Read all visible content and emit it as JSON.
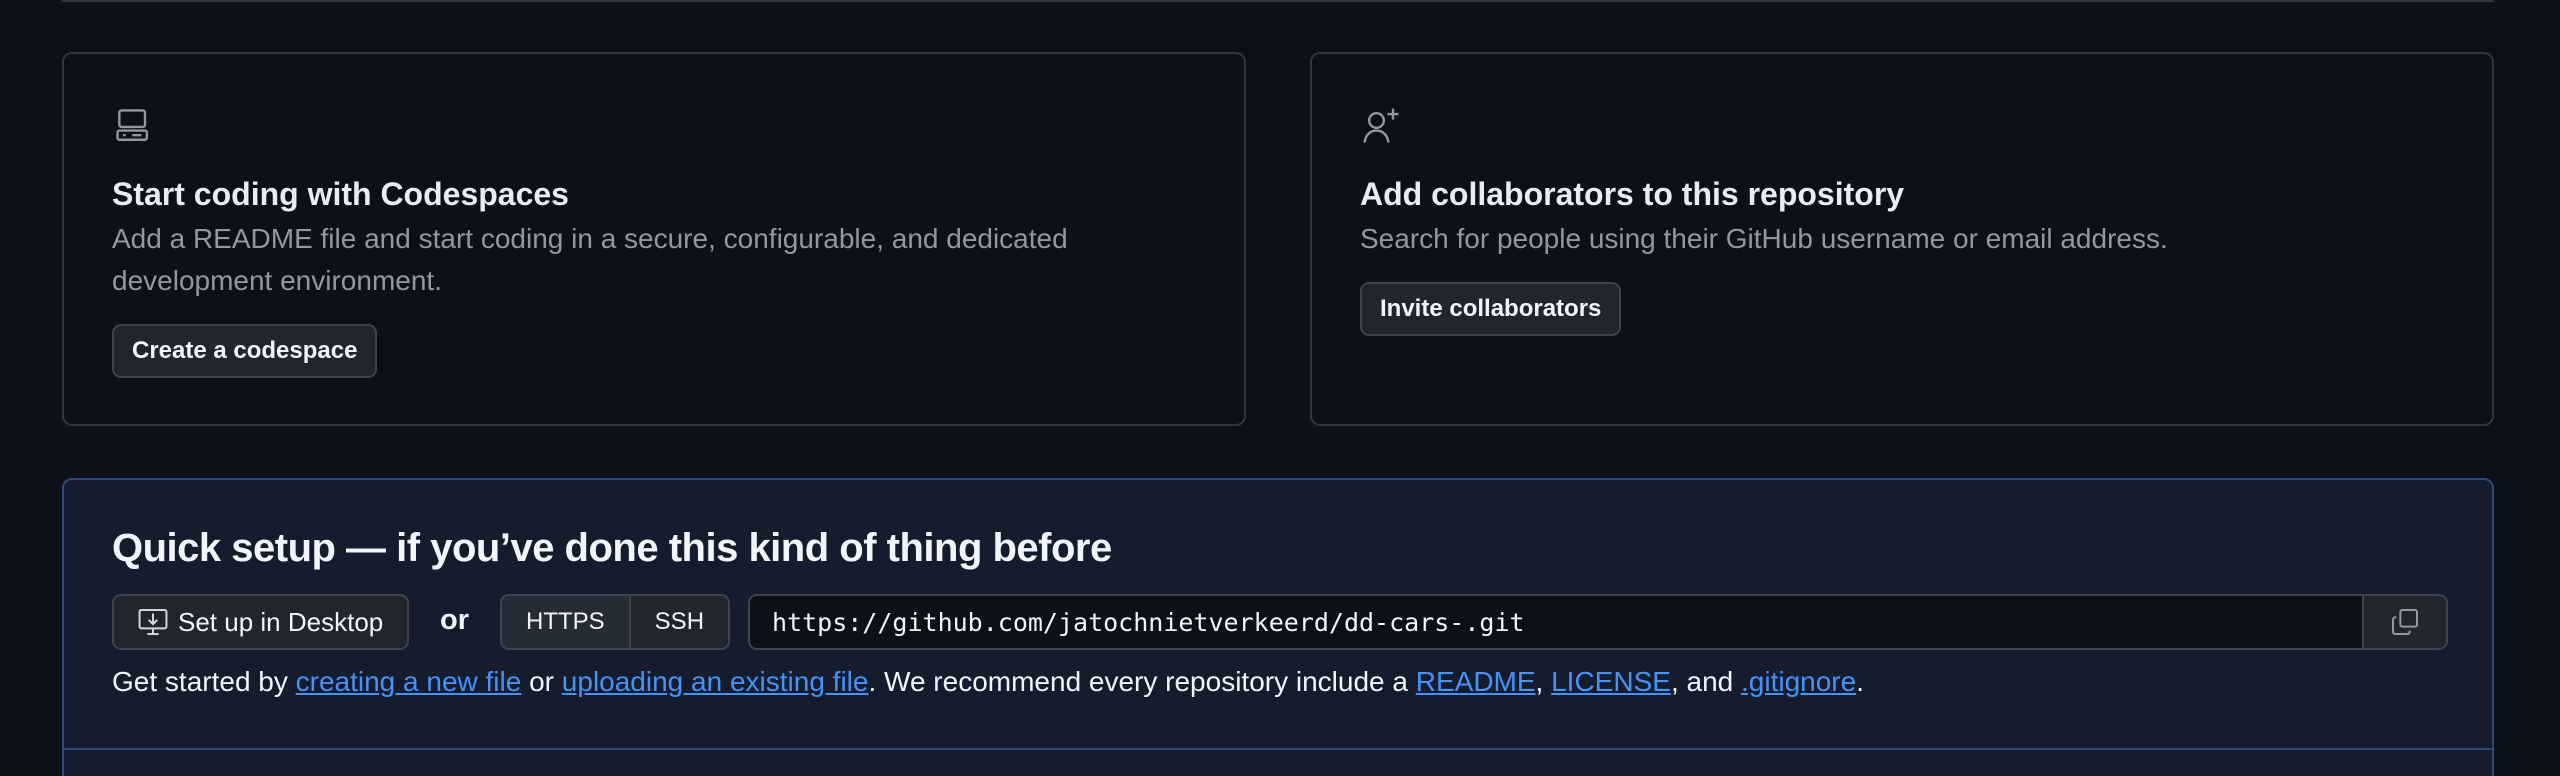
{
  "codespaces_card": {
    "icon": "codespaces-icon",
    "title": "Start coding with Codespaces",
    "description": "Add a README file and start coding in a secure, configurable, and dedicated development environment.",
    "button_label": "Create a codespace"
  },
  "collaborators_card": {
    "icon": "person-add-icon",
    "title": "Add collaborators to this repository",
    "description": "Search for people using their GitHub username or email address.",
    "button_label": "Invite collaborators"
  },
  "quick_setup": {
    "title": "Quick setup — if you’ve done this kind of thing before",
    "desktop_button_label": "Set up in Desktop",
    "desktop_icon": "desktop-download-icon",
    "or_label": "or",
    "protocols": [
      "HTTPS",
      "SSH"
    ],
    "selected_protocol": "HTTPS",
    "clone_url": "https://github.com/jatochnietverkeerd/dd-cars-.git",
    "copy_icon": "copy-icon",
    "help": {
      "prefix": "Get started by ",
      "link_new_file": "creating a new file",
      "or": " or ",
      "link_upload": "uploading an existing file",
      "middle": ". We recommend every repository include a ",
      "link_readme": "README",
      "comma": ", ",
      "link_license": "LICENSE",
      "and": ", and ",
      "link_gitignore": ".gitignore",
      "suffix": "."
    }
  },
  "colors": {
    "background": "#0d1117",
    "border": "#30363d",
    "quick_setup_bg": "#151c2d",
    "quick_setup_border": "#2d4a7a",
    "link": "#4493f8",
    "muted_text": "#9198a1"
  }
}
